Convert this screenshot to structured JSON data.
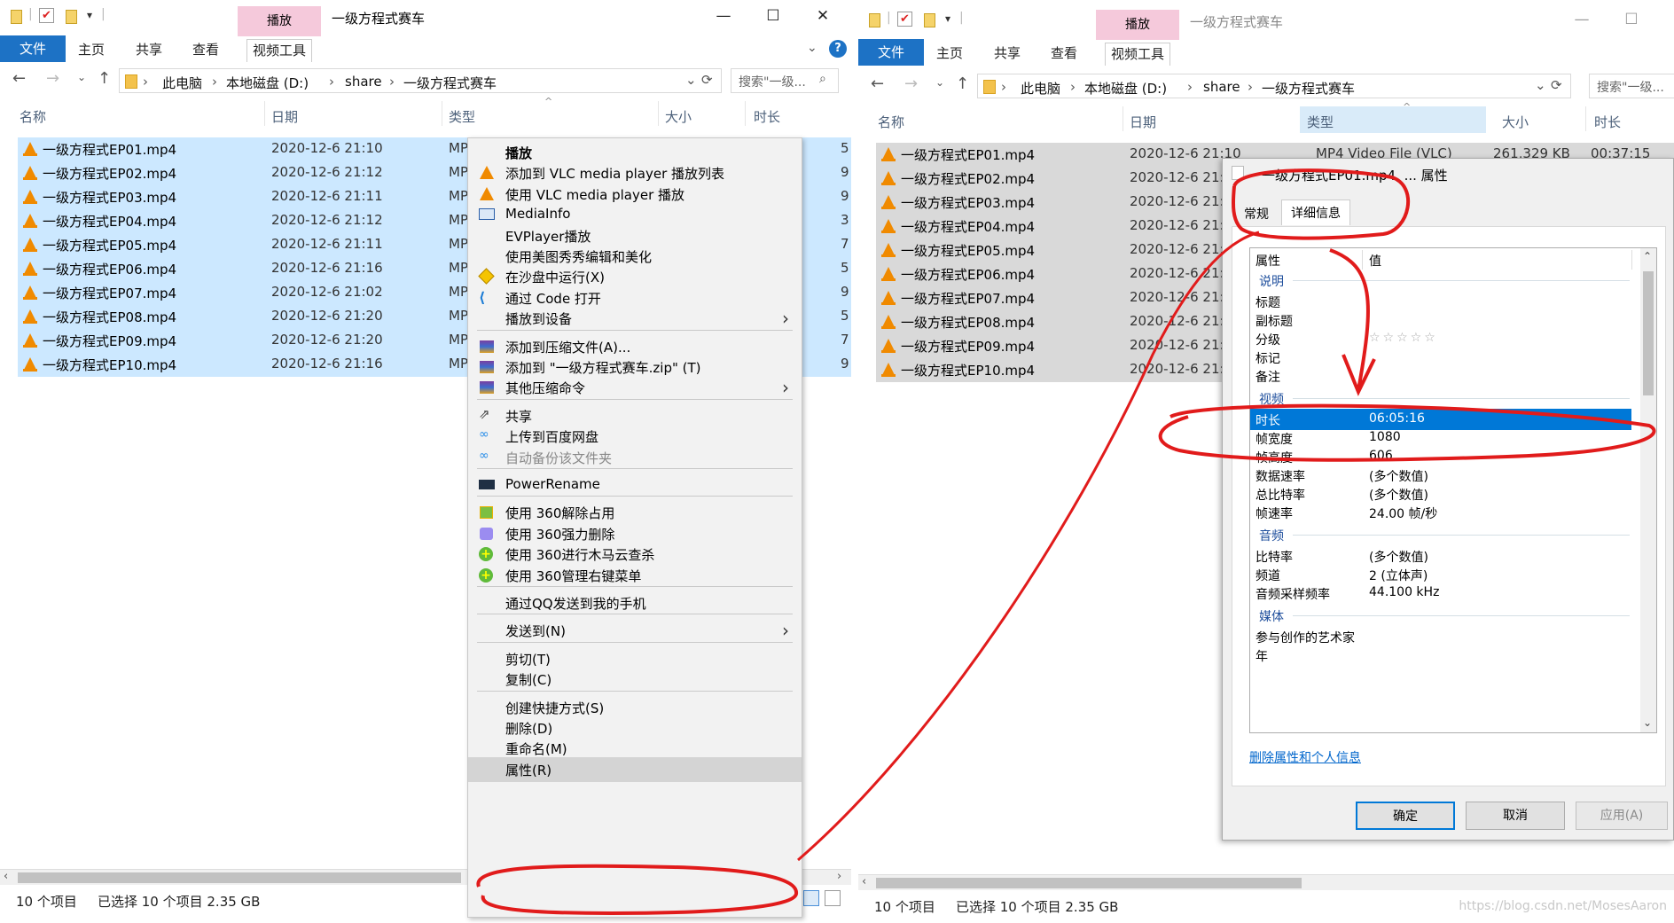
{
  "left_window": {
    "ribbon_context_group": "播放",
    "title": "一级方程式赛车",
    "ribbon_tabs": [
      "文件",
      "主页",
      "共享",
      "查看",
      "视频工具"
    ],
    "breadcrumb": [
      "此电脑",
      "本地磁盘 (D:)",
      "share",
      "一级方程式赛车"
    ],
    "search_placeholder": "搜索\"一级...",
    "columns": [
      "名称",
      "日期",
      "类型",
      "大小",
      "时长"
    ],
    "files": [
      {
        "name": "一级方程式EP01.mp4",
        "date": "2020-12-6 21:10",
        "type_partial": "MP",
        "dur_partial": "5"
      },
      {
        "name": "一级方程式EP02.mp4",
        "date": "2020-12-6 21:12",
        "type_partial": "MP",
        "dur_partial": "9"
      },
      {
        "name": "一级方程式EP03.mp4",
        "date": "2020-12-6 21:11",
        "type_partial": "MP",
        "dur_partial": "9"
      },
      {
        "name": "一级方程式EP04.mp4",
        "date": "2020-12-6 21:12",
        "type_partial": "MP",
        "dur_partial": "3"
      },
      {
        "name": "一级方程式EP05.mp4",
        "date": "2020-12-6 21:11",
        "type_partial": "MP",
        "dur_partial": "7"
      },
      {
        "name": "一级方程式EP06.mp4",
        "date": "2020-12-6 21:16",
        "type_partial": "MP",
        "dur_partial": "5"
      },
      {
        "name": "一级方程式EP07.mp4",
        "date": "2020-12-6 21:02",
        "type_partial": "MP",
        "dur_partial": "9"
      },
      {
        "name": "一级方程式EP08.mp4",
        "date": "2020-12-6 21:20",
        "type_partial": "MP",
        "dur_partial": "5"
      },
      {
        "name": "一级方程式EP09.mp4",
        "date": "2020-12-6 21:20",
        "type_partial": "MP",
        "dur_partial": "7"
      },
      {
        "name": "一级方程式EP10.mp4",
        "date": "2020-12-6 21:16",
        "type_partial": "MP",
        "dur_partial": "9"
      }
    ],
    "status_count": "10 个项目",
    "status_selected": "已选择 10 个项目  2.35 GB"
  },
  "context_menu": {
    "items": [
      {
        "label": "播放",
        "icon": "none",
        "bold": true
      },
      {
        "label": "添加到 VLC media player 播放列表",
        "icon": "vlc-icon"
      },
      {
        "label": "使用 VLC media player 播放",
        "icon": "vlc-icon"
      },
      {
        "label": "MediaInfo",
        "icon": "mediainfo-icon"
      },
      {
        "label": "EVPlayer播放",
        "icon": "none"
      },
      {
        "label": "使用美图秀秀编辑和美化",
        "icon": "none"
      },
      {
        "label": "在沙盘中运行(X)",
        "icon": "sandbox-icon"
      },
      {
        "label": "通过 Code 打开",
        "icon": "vscode-icon"
      },
      {
        "label": "播放到设备",
        "icon": "none",
        "submenu": true
      },
      {
        "label": "添加到压缩文件(A)...",
        "icon": "winrar-icon"
      },
      {
        "label": "添加到 \"一级方程式赛车.zip\" (T)",
        "icon": "winrar-icon"
      },
      {
        "label": "其他压缩命令",
        "icon": "winrar-icon",
        "submenu": true
      },
      {
        "label": "共享",
        "icon": "share-icon"
      },
      {
        "label": "上传到百度网盘",
        "icon": "baidu-icon"
      },
      {
        "label": "自动备份该文件夹",
        "icon": "baidu-icon",
        "disabled": true
      },
      {
        "label": "PowerRename",
        "icon": "powerrename-icon"
      },
      {
        "label": "使用 360解除占用",
        "icon": "360-unlock-icon"
      },
      {
        "label": "使用 360强力删除",
        "icon": "360-delete-icon"
      },
      {
        "label": "使用 360进行木马云查杀",
        "icon": "360-plus-icon"
      },
      {
        "label": "使用 360管理右键菜单",
        "icon": "360-plus-icon"
      },
      {
        "label": "通过QQ发送到我的手机",
        "icon": "none"
      },
      {
        "label": "发送到(N)",
        "icon": "none",
        "submenu": true
      },
      {
        "label": "剪切(T)",
        "icon": "none"
      },
      {
        "label": "复制(C)",
        "icon": "none"
      },
      {
        "label": "创建快捷方式(S)",
        "icon": "none"
      },
      {
        "label": "删除(D)",
        "icon": "none"
      },
      {
        "label": "重命名(M)",
        "icon": "none"
      },
      {
        "label": "属性(R)",
        "icon": "none",
        "highlighted": true
      }
    ]
  },
  "right_window": {
    "ribbon_context_group": "播放",
    "title": "一级方程式赛车",
    "ribbon_tabs": [
      "文件",
      "主页",
      "共享",
      "查看",
      "视频工具"
    ],
    "breadcrumb": [
      "此电脑",
      "本地磁盘 (D:)",
      "share",
      "一级方程式赛车"
    ],
    "search_placeholder": "搜索\"一级...",
    "columns": [
      "名称",
      "日期",
      "类型",
      "大小",
      "时长"
    ],
    "first_row": {
      "type": "MP4 Video File (VLC)",
      "size": "261,329 KB",
      "duration": "00:37:15"
    },
    "files": [
      {
        "name": "一级方程式EP01.mp4",
        "date": "2020-12-6 21:10"
      },
      {
        "name": "一级方程式EP02.mp4",
        "date": "2020-12-6 21:"
      },
      {
        "name": "一级方程式EP03.mp4",
        "date": "2020-12-6 21:"
      },
      {
        "name": "一级方程式EP04.mp4",
        "date": "2020-12-6 21:"
      },
      {
        "name": "一级方程式EP05.mp4",
        "date": "2020-12-6 21:"
      },
      {
        "name": "一级方程式EP06.mp4",
        "date": "2020-12-6 21:"
      },
      {
        "name": "一级方程式EP07.mp4",
        "date": "2020-12-6 21:"
      },
      {
        "name": "一级方程式EP08.mp4",
        "date": "2020-12-6 21:"
      },
      {
        "name": "一级方程式EP09.mp4",
        "date": "2020-12-6 21:"
      },
      {
        "name": "一级方程式EP10.mp4",
        "date": "2020-12-6 21:"
      }
    ],
    "status_count": "10 个项目",
    "status_selected": "已选择 10 个项目  2.35 GB"
  },
  "properties_dialog": {
    "title": "一级方程式EP01.mp4, ... 属性",
    "tabs": [
      "常规",
      "详细信息"
    ],
    "header_key": "属性",
    "header_value": "值",
    "groups": [
      {
        "name": "说明",
        "rows": [
          {
            "k": "标题",
            "v": ""
          },
          {
            "k": "副标题",
            "v": ""
          },
          {
            "k": "分级",
            "v": "☆☆☆☆☆"
          },
          {
            "k": "标记",
            "v": ""
          },
          {
            "k": "备注",
            "v": ""
          }
        ]
      },
      {
        "name": "视频",
        "rows": [
          {
            "k": "时长",
            "v": "06:05:16",
            "selected": true
          },
          {
            "k": "帧宽度",
            "v": "1080"
          },
          {
            "k": "帧高度",
            "v": "606"
          },
          {
            "k": "数据速率",
            "v": "(多个数值)"
          },
          {
            "k": "总比特率",
            "v": "(多个数值)"
          },
          {
            "k": "帧速率",
            "v": "24.00 帧/秒"
          }
        ]
      },
      {
        "name": "音频",
        "rows": [
          {
            "k": "比特率",
            "v": "(多个数值)"
          },
          {
            "k": "频道",
            "v": "2 (立体声)"
          },
          {
            "k": "音频采样频率",
            "v": "44.100 kHz"
          }
        ]
      },
      {
        "name": "媒体",
        "rows": [
          {
            "k": "参与创作的艺术家",
            "v": ""
          },
          {
            "k": "年",
            "v": ""
          }
        ]
      }
    ],
    "remove_link": "删除属性和个人信息",
    "buttons": {
      "ok": "确定",
      "cancel": "取消",
      "apply": "应用(A)"
    }
  },
  "watermark": "https://blog.csdn.net/MosesAaron",
  "colors": {
    "accent": "#1d72c5",
    "selection": "#cce8ff",
    "annotation": "#e11b1b",
    "context_tab": "#f5c9db"
  }
}
